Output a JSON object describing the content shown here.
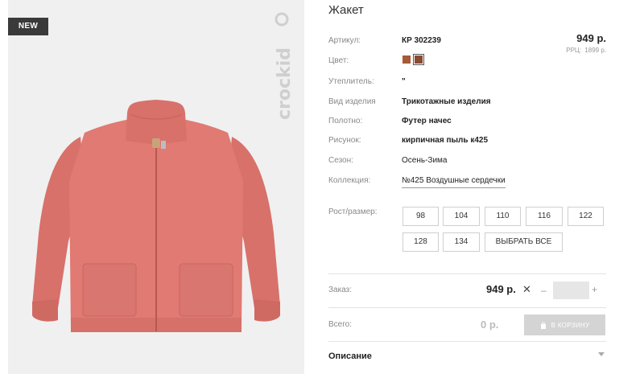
{
  "product_image": {
    "badge": "NEW",
    "brand_logo_text": "crockid",
    "jacket_color": "#e07a72"
  },
  "product": {
    "title": "Жакет",
    "price": "949 р.",
    "rrc_label": "РРЦ:",
    "rrc_value": "1899 р."
  },
  "attributes": {
    "article": {
      "label": "Артикул:",
      "value": "КР 302239"
    },
    "color": {
      "label": "Цвет:",
      "swatches": [
        "#a65a35",
        "#8a4a33"
      ]
    },
    "insulation": {
      "label": "Утеплитель:",
      "value": "\""
    },
    "product_type": {
      "label": "Вид изделия",
      "value": "Трикотажные изделия"
    },
    "fabric": {
      "label": "Полотно:",
      "value": "Футер начес"
    },
    "pattern": {
      "label": "Рисунок:",
      "value": "кирпичная пыль к425"
    },
    "season": {
      "label": "Сезон:",
      "value": "Осень-Зима"
    },
    "collection": {
      "label": "Коллекция:",
      "value": "№425 Воздушные сердечки"
    }
  },
  "sizes": {
    "label": "Рост/размер:",
    "options": [
      "98",
      "104",
      "110",
      "116",
      "122",
      "128",
      "134"
    ],
    "select_all": "ВЫБРАТЬ ВСЕ"
  },
  "order": {
    "label": "Заказ:",
    "price": "949 р.",
    "multiply_symbol": "✕",
    "minus": "–",
    "plus": "+",
    "quantity_value": ""
  },
  "total": {
    "label": "Всего:",
    "value": "0 р.",
    "cart_button": "В КОРЗИНУ"
  },
  "description": {
    "label": "Описание"
  }
}
